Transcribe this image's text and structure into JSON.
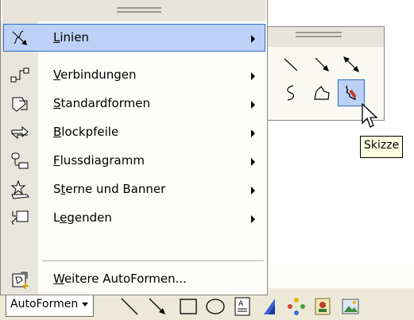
{
  "menu": {
    "items": [
      {
        "accel": "L",
        "rest": "inien",
        "icon": "lines-icon",
        "submenu": true,
        "selected": true
      },
      {
        "accel": "V",
        "rest": "erbindungen",
        "icon": "connectors-icon",
        "submenu": true
      },
      {
        "accel": "S",
        "rest": "tandardformen",
        "icon": "basic-shapes-icon",
        "submenu": true
      },
      {
        "accel": "B",
        "rest": "lockpfeile",
        "icon": "block-arrows-icon",
        "submenu": true
      },
      {
        "accel": "F",
        "rest": "lussdiagramm",
        "icon": "flowchart-icon",
        "submenu": true
      },
      {
        "pre": "S",
        "accel": "t",
        "rest": "erne und Banner",
        "icon": "stars-banners-icon",
        "submenu": true
      },
      {
        "pre": "L",
        "accel": "e",
        "rest": "genden",
        "icon": "callouts-icon",
        "submenu": true
      },
      {
        "accel": "W",
        "rest": "eitere AutoFormen...",
        "icon": "more-autoshapes-icon",
        "submenu": false
      }
    ]
  },
  "lines_submenu": {
    "tools": [
      "line-icon",
      "arrow-icon",
      "double-arrow-icon",
      "curve-icon",
      "freeform-icon",
      "scribble-icon"
    ],
    "active_tool": "scribble-icon"
  },
  "tooltip": {
    "text": "Skizze"
  },
  "toolbar": {
    "autoshapes_label": "AutoFormen",
    "buttons": [
      "line-icon",
      "arrow-icon",
      "rectangle-icon",
      "oval-icon",
      "text-box-icon",
      "wordart-icon",
      "diagram-icon",
      "clip-art-icon",
      "picture-icon"
    ]
  },
  "colors": {
    "highlight": "#bcd1f5",
    "highlight_border": "#316ac5",
    "menu_background": "#fcfcf9",
    "icon_strip": "#e8e6dc",
    "tooltip_background": "#ffffe1"
  }
}
